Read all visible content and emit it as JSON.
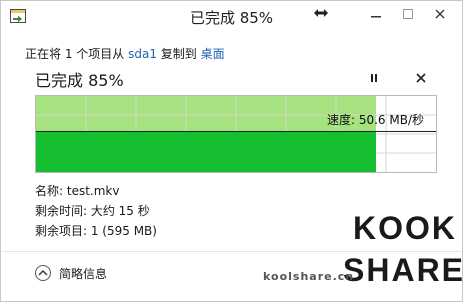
{
  "window": {
    "title": "已完成 85%"
  },
  "status": {
    "prefix": "正在将 1 个项目从",
    "source": "sda1",
    "middle": "复制到",
    "destination": "桌面"
  },
  "progress": {
    "headline": "已完成 85%",
    "percent": 85,
    "speed_label": "速度: 50.6 MB/秒",
    "colors": {
      "completed_bg": "#a6e27f",
      "throughput_fill": "#16bf2f"
    }
  },
  "details": {
    "name": "名称: test.mkv",
    "time_remaining": "剩余时间: 大约 15 秒",
    "items_remaining": "剩余项目: 1 (595 MB)"
  },
  "footer": {
    "toggle_label": "简略信息"
  },
  "watermark": {
    "brand_top": "KOOK",
    "brand_bottom": "SHARE",
    "site": "koolshare.cn"
  },
  "icons": {
    "app": "copy-file-icon",
    "resize": "resize-arrows-icon",
    "minimize": "minimize-icon",
    "maximize": "maximize-icon",
    "close": "close-icon",
    "pause": "pause-icon",
    "cancel": "close-icon",
    "toggle": "chevron-up-icon"
  }
}
